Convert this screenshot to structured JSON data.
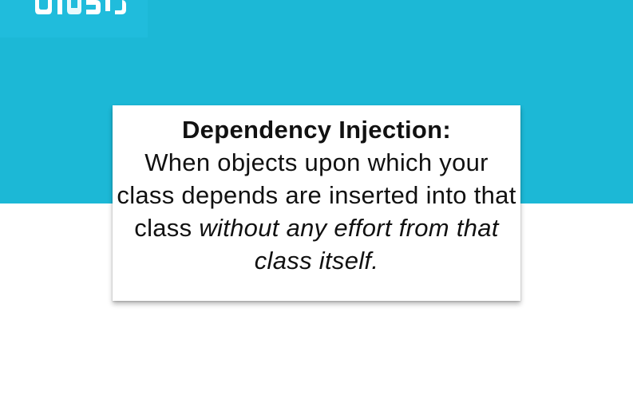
{
  "colors": {
    "band": "#1cb8d6",
    "logo_tile": "#20bcdc",
    "card_background": "#ffffff",
    "text": "#111111"
  },
  "logo": {
    "icon": "brand-logo-icon"
  },
  "card": {
    "title": "Dependency Injection:",
    "body_plain": "When objects upon which your class depends are inserted into that class",
    "body_italic": "without any effort from that class itself."
  }
}
